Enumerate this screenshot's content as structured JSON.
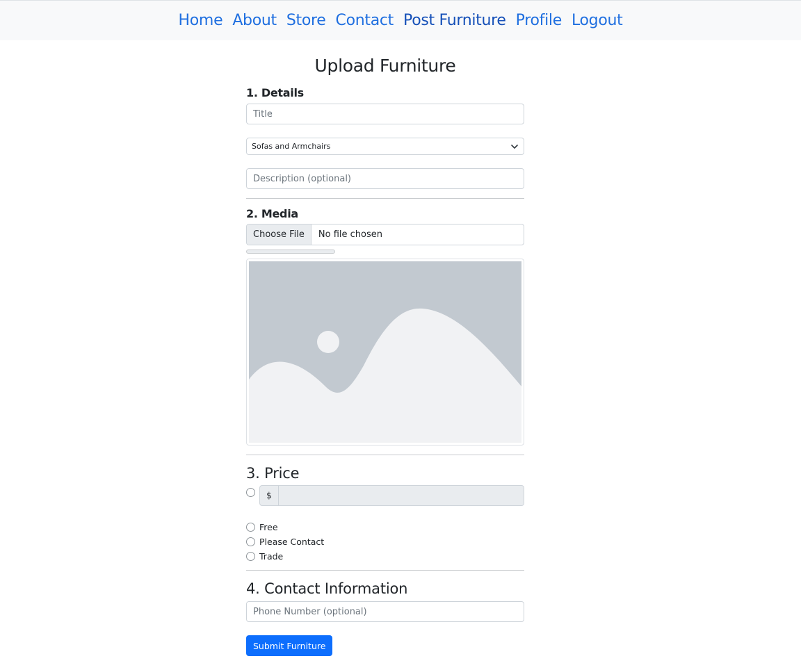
{
  "nav": {
    "items": [
      {
        "label": "Home"
      },
      {
        "label": "About"
      },
      {
        "label": "Store"
      },
      {
        "label": "Contact"
      },
      {
        "label": "Post Furniture"
      },
      {
        "label": "Profile"
      },
      {
        "label": "Logout"
      }
    ]
  },
  "page": {
    "title": "Upload Furniture"
  },
  "details": {
    "heading": "1. Details",
    "title_placeholder": "Title",
    "category_selected": "Sofas and Armchairs",
    "description_placeholder": "Description (optional)"
  },
  "media": {
    "heading": "2. Media",
    "choose_file_label": "Choose File",
    "file_status": "No file chosen",
    "upload_progress": 0,
    "preview_icon": "image-placeholder-icon"
  },
  "price": {
    "heading": "3. Price",
    "currency_symbol": "$",
    "options": [
      {
        "label": "Free"
      },
      {
        "label": "Please Contact"
      },
      {
        "label": "Trade"
      }
    ]
  },
  "contact": {
    "heading": "4. Contact Information",
    "phone_placeholder": "Phone Number (optional)"
  },
  "submit": {
    "label": "Submit Furniture"
  },
  "colors": {
    "link": "#1f6fe0",
    "primary": "#0d6efd",
    "navbar_bg": "#f8f9fa",
    "placeholder_bg": "#c2c9d0",
    "placeholder_fg": "#f1f2f4"
  }
}
